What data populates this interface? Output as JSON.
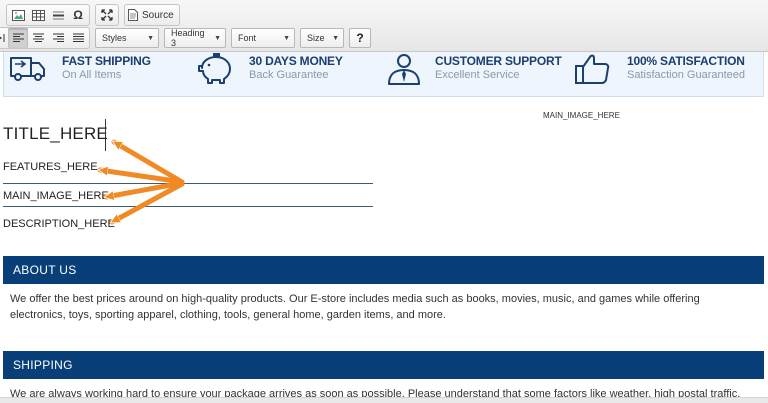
{
  "toolbar": {
    "source_label": "Source",
    "styles_label": "Styles",
    "format_label": "Heading 3",
    "font_label": "Font",
    "size_label": "Size",
    "help_label": "?"
  },
  "features": [
    {
      "title": "FAST SHIPPING",
      "subtitle": "On All Items",
      "icon": "truck-icon"
    },
    {
      "title": "30 DAYS MONEY",
      "subtitle": "Back Guarantee",
      "icon": "piggy-bank-icon"
    },
    {
      "title": "CUSTOMER SUPPORT",
      "subtitle": "Excellent Service",
      "icon": "support-agent-icon"
    },
    {
      "title": "100% SATISFACTION",
      "subtitle": "Satisfaction Guaranteed",
      "icon": "thumbs-up-icon"
    }
  ],
  "editor": {
    "main_image_small": "MAIN_IMAGE_HERE",
    "title": "TITLE_HERE",
    "features": "FEATURES_HERE",
    "main_image": "MAIN_IMAGE_HERE",
    "description": "DESCRIPTION_HERE"
  },
  "about": {
    "heading": "ABOUT US",
    "text": "We offer the best prices around on high-quality products. Our E-store includes media such as books, movies, music, and games while offering electronics, toys, sporting apparel, clothing, tools, general home, garden items, and more."
  },
  "shipping": {
    "heading": "SHIPPING",
    "text": "We are always working hard to ensure your package arrives as soon as possible. Please understand that some factors like weather, high postal traffic,"
  },
  "colors": {
    "section_header": "#083f78",
    "feature_title": "#1b3f6e",
    "arrow": "#f08a24"
  }
}
